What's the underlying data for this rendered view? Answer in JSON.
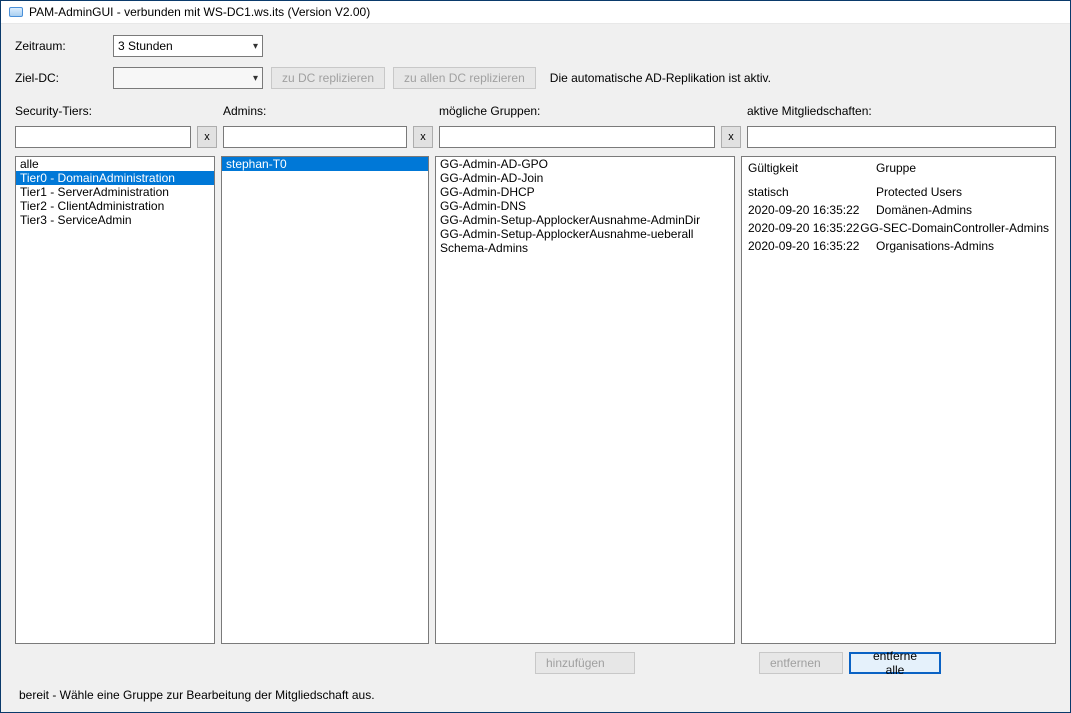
{
  "title": "PAM-AdminGUI - verbunden mit WS-DC1.ws.its (Version V2.00)",
  "labels": {
    "zeitraum": "Zeitraum:",
    "zieldc": "Ziel-DC:"
  },
  "zeitraum_value": "3 Stunden",
  "zieldc_value": "",
  "buttons": {
    "replicate_dc": "zu DC replizieren",
    "replicate_all": "zu allen DC replizieren",
    "add": "hinzufügen",
    "remove": "entfernen",
    "remove_all": "entferne alle",
    "x": "x"
  },
  "info_text": "Die automatische AD-Replikation ist aktiv.",
  "headers": {
    "tiers": "Security-Tiers:",
    "admins": "Admins:",
    "groups": "mögliche Gruppen:",
    "memberships": "aktive Mitgliedschaften:"
  },
  "filters": {
    "tiers": "",
    "admins": "",
    "groups": "",
    "memberships": ""
  },
  "tiers": [
    {
      "label": "alle",
      "selected": false
    },
    {
      "label": "Tier0 - DomainAdministration",
      "selected": true
    },
    {
      "label": "Tier1 - ServerAdministration",
      "selected": false
    },
    {
      "label": "Tier2 - ClientAdministration",
      "selected": false
    },
    {
      "label": "Tier3 - ServiceAdmin",
      "selected": false
    }
  ],
  "admins": [
    {
      "label": "stephan-T0",
      "selected": true
    }
  ],
  "groups": [
    "GG-Admin-AD-GPO",
    "GG-Admin-AD-Join",
    "GG-Admin-DHCP",
    "GG-Admin-DNS",
    "GG-Admin-Setup-ApplockerAusnahme-AdminDir",
    "GG-Admin-Setup-ApplockerAusnahme-ueberall",
    "Schema-Admins"
  ],
  "memberships": {
    "columns": {
      "validity": "Gültigkeit",
      "group": "Gruppe"
    },
    "rows": [
      {
        "validity": "statisch",
        "group": "Protected Users"
      },
      {
        "validity": "2020-09-20 16:35:22",
        "group": "Domänen-Admins"
      },
      {
        "validity": "2020-09-20 16:35:22",
        "group": "GG-SEC-DomainController-Admins"
      },
      {
        "validity": "2020-09-20 16:35:22",
        "group": "Organisations-Admins"
      }
    ]
  },
  "status": "bereit - Wähle eine Gruppe zur Bearbeitung der Mitgliedschaft aus."
}
